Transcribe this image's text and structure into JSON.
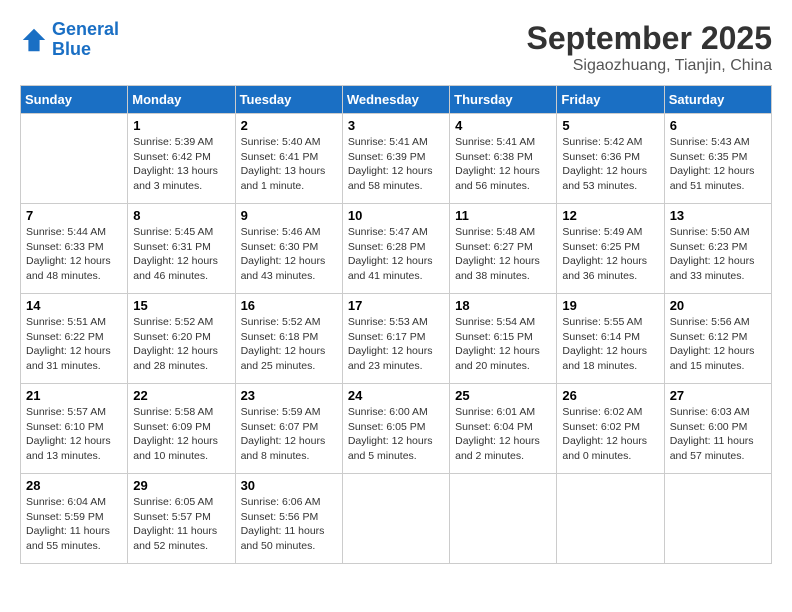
{
  "header": {
    "logo_line1": "General",
    "logo_line2": "Blue",
    "month": "September 2025",
    "location": "Sigaozhuang, Tianjin, China"
  },
  "weekdays": [
    "Sunday",
    "Monday",
    "Tuesday",
    "Wednesday",
    "Thursday",
    "Friday",
    "Saturday"
  ],
  "weeks": [
    [
      {
        "day": "",
        "info": ""
      },
      {
        "day": "1",
        "info": "Sunrise: 5:39 AM\nSunset: 6:42 PM\nDaylight: 13 hours\nand 3 minutes."
      },
      {
        "day": "2",
        "info": "Sunrise: 5:40 AM\nSunset: 6:41 PM\nDaylight: 13 hours\nand 1 minute."
      },
      {
        "day": "3",
        "info": "Sunrise: 5:41 AM\nSunset: 6:39 PM\nDaylight: 12 hours\nand 58 minutes."
      },
      {
        "day": "4",
        "info": "Sunrise: 5:41 AM\nSunset: 6:38 PM\nDaylight: 12 hours\nand 56 minutes."
      },
      {
        "day": "5",
        "info": "Sunrise: 5:42 AM\nSunset: 6:36 PM\nDaylight: 12 hours\nand 53 minutes."
      },
      {
        "day": "6",
        "info": "Sunrise: 5:43 AM\nSunset: 6:35 PM\nDaylight: 12 hours\nand 51 minutes."
      }
    ],
    [
      {
        "day": "7",
        "info": "Sunrise: 5:44 AM\nSunset: 6:33 PM\nDaylight: 12 hours\nand 48 minutes."
      },
      {
        "day": "8",
        "info": "Sunrise: 5:45 AM\nSunset: 6:31 PM\nDaylight: 12 hours\nand 46 minutes."
      },
      {
        "day": "9",
        "info": "Sunrise: 5:46 AM\nSunset: 6:30 PM\nDaylight: 12 hours\nand 43 minutes."
      },
      {
        "day": "10",
        "info": "Sunrise: 5:47 AM\nSunset: 6:28 PM\nDaylight: 12 hours\nand 41 minutes."
      },
      {
        "day": "11",
        "info": "Sunrise: 5:48 AM\nSunset: 6:27 PM\nDaylight: 12 hours\nand 38 minutes."
      },
      {
        "day": "12",
        "info": "Sunrise: 5:49 AM\nSunset: 6:25 PM\nDaylight: 12 hours\nand 36 minutes."
      },
      {
        "day": "13",
        "info": "Sunrise: 5:50 AM\nSunset: 6:23 PM\nDaylight: 12 hours\nand 33 minutes."
      }
    ],
    [
      {
        "day": "14",
        "info": "Sunrise: 5:51 AM\nSunset: 6:22 PM\nDaylight: 12 hours\nand 31 minutes."
      },
      {
        "day": "15",
        "info": "Sunrise: 5:52 AM\nSunset: 6:20 PM\nDaylight: 12 hours\nand 28 minutes."
      },
      {
        "day": "16",
        "info": "Sunrise: 5:52 AM\nSunset: 6:18 PM\nDaylight: 12 hours\nand 25 minutes."
      },
      {
        "day": "17",
        "info": "Sunrise: 5:53 AM\nSunset: 6:17 PM\nDaylight: 12 hours\nand 23 minutes."
      },
      {
        "day": "18",
        "info": "Sunrise: 5:54 AM\nSunset: 6:15 PM\nDaylight: 12 hours\nand 20 minutes."
      },
      {
        "day": "19",
        "info": "Sunrise: 5:55 AM\nSunset: 6:14 PM\nDaylight: 12 hours\nand 18 minutes."
      },
      {
        "day": "20",
        "info": "Sunrise: 5:56 AM\nSunset: 6:12 PM\nDaylight: 12 hours\nand 15 minutes."
      }
    ],
    [
      {
        "day": "21",
        "info": "Sunrise: 5:57 AM\nSunset: 6:10 PM\nDaylight: 12 hours\nand 13 minutes."
      },
      {
        "day": "22",
        "info": "Sunrise: 5:58 AM\nSunset: 6:09 PM\nDaylight: 12 hours\nand 10 minutes."
      },
      {
        "day": "23",
        "info": "Sunrise: 5:59 AM\nSunset: 6:07 PM\nDaylight: 12 hours\nand 8 minutes."
      },
      {
        "day": "24",
        "info": "Sunrise: 6:00 AM\nSunset: 6:05 PM\nDaylight: 12 hours\nand 5 minutes."
      },
      {
        "day": "25",
        "info": "Sunrise: 6:01 AM\nSunset: 6:04 PM\nDaylight: 12 hours\nand 2 minutes."
      },
      {
        "day": "26",
        "info": "Sunrise: 6:02 AM\nSunset: 6:02 PM\nDaylight: 12 hours\nand 0 minutes."
      },
      {
        "day": "27",
        "info": "Sunrise: 6:03 AM\nSunset: 6:00 PM\nDaylight: 11 hours\nand 57 minutes."
      }
    ],
    [
      {
        "day": "28",
        "info": "Sunrise: 6:04 AM\nSunset: 5:59 PM\nDaylight: 11 hours\nand 55 minutes."
      },
      {
        "day": "29",
        "info": "Sunrise: 6:05 AM\nSunset: 5:57 PM\nDaylight: 11 hours\nand 52 minutes."
      },
      {
        "day": "30",
        "info": "Sunrise: 6:06 AM\nSunset: 5:56 PM\nDaylight: 11 hours\nand 50 minutes."
      },
      {
        "day": "",
        "info": ""
      },
      {
        "day": "",
        "info": ""
      },
      {
        "day": "",
        "info": ""
      },
      {
        "day": "",
        "info": ""
      }
    ]
  ]
}
